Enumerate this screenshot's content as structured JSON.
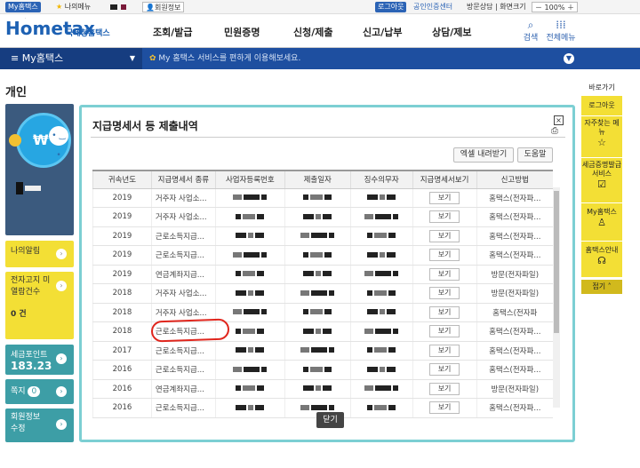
{
  "util": {
    "myhometax": "My홈택스",
    "favorites": "나의메뉴",
    "member_info": "회원정보",
    "logout": "로그아웃",
    "cert_center": "공인인증센터",
    "links": "방문상담 | 화면크기",
    "zoom": "100%"
  },
  "header": {
    "logo": "Hometax",
    "logo_sub": "국세청홈택스",
    "nav": [
      "조회/발급",
      "민원증명",
      "신청/제출",
      "신고/납부",
      "상담/제보"
    ],
    "search_label": "검색",
    "allmenu_label": "전체메뉴"
  },
  "mybar": {
    "title": "My홈택스",
    "message": "My 홈택스 서비스를 편하게 이용해보세요."
  },
  "page": {
    "title": "개인"
  },
  "left": {
    "myinfo": "나의알림",
    "unpaid_title": "전자고지 미열람건수",
    "unpaid_count": "0 건",
    "points_title": "세금포인트",
    "points_value": "183.23",
    "message_label": "쪽지",
    "message_count": "0",
    "member_edit": "회원정보 수정"
  },
  "modal": {
    "title": "지급명세서 등 제출내역",
    "excel_btn": "엑셀 내려받기",
    "help_btn": "도움말",
    "close_btn": "닫기",
    "columns": [
      "귀속년도",
      "지급명세서 종류",
      "사업자등록번호",
      "제출일자",
      "징수의무자",
      "지급명세서보기",
      "신고방법"
    ],
    "rows": [
      {
        "year": "2019",
        "type": "거주자 사업소...",
        "view": "보기",
        "method": "홈택스(전자파..."
      },
      {
        "year": "2019",
        "type": "거주자 사업소...",
        "view": "보기",
        "method": "홈택스(전자파..."
      },
      {
        "year": "2019",
        "type": "근로소득지급...",
        "view": "보기",
        "method": "홈택스(전자파..."
      },
      {
        "year": "2019",
        "type": "근로소득지급...",
        "view": "보기",
        "method": "홈택스(전자파..."
      },
      {
        "year": "2019",
        "type": "연금계좌지급...",
        "view": "보기",
        "method": "방문(전자파일)"
      },
      {
        "year": "2018",
        "type": "거주자 사업소...",
        "view": "보기",
        "method": "방문(전자파일)"
      },
      {
        "year": "2018",
        "type": "거주자 사업소...",
        "view": "보기",
        "method": "홈택스(전자파"
      },
      {
        "year": "2018",
        "type": "근로소득지급...",
        "view": "보기",
        "method": "홈택스(전자파..."
      },
      {
        "year": "2017",
        "type": "근로소득지급...",
        "view": "보기",
        "method": "홈택스(전자파..."
      },
      {
        "year": "2016",
        "type": "근로소득지급...",
        "view": "보기",
        "method": "홈택스(전자파..."
      },
      {
        "year": "2016",
        "type": "연금계좌지급...",
        "view": "보기",
        "method": "방문(전자파일)"
      },
      {
        "year": "2016",
        "type": "근로소득지급...",
        "view": "보기",
        "method": "홈택스(전자파..."
      }
    ]
  },
  "right": {
    "title": "바로가기",
    "items": [
      "로그아웃",
      "자주찾는 메뉴",
      "세금증명발급 서비스",
      "My홈택스",
      "홈택스안내"
    ],
    "collapse": "접기"
  }
}
